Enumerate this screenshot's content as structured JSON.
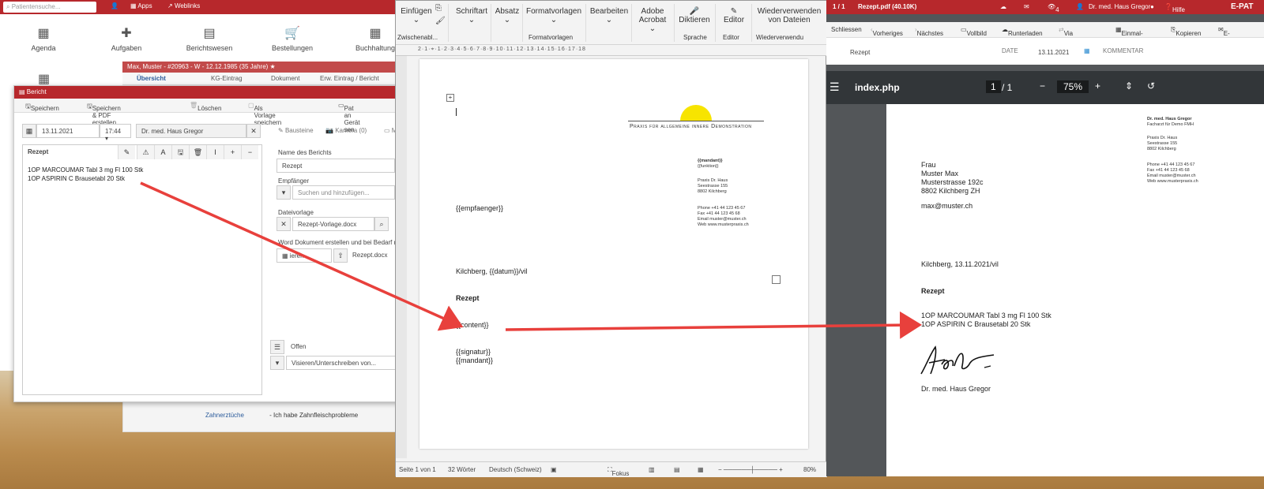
{
  "epat": {
    "search_placeholder": "Patientensuche...",
    "apps": "Apps",
    "weblinks": "Weblinks",
    "tiles": [
      "Agenda",
      "Aufgaben",
      "Berichtswesen",
      "Bestellungen",
      "Buchhaltung"
    ],
    "patient_header": "Max, Muster - #20963 - W - 12.12.1985 (35 Jahre)",
    "patient_tabs": [
      "Übersicht",
      "KG-Eintrag",
      "Dokument",
      "Erw. Eintrag / Bericht"
    ],
    "zahn_link": "Zahnerztüche",
    "zahn_text": "- Ich habe Zahnfleischprobleme"
  },
  "bericht": {
    "title": "Bericht",
    "toolbar": {
      "save": "Speichern",
      "save_pdf": "Speichern & PDF erstellen",
      "delete": "Löschen",
      "as_template": "Als Vorlage speichern",
      "device": "Pat an Gerät sen"
    },
    "date": "13.11.2021",
    "time": "17:44",
    "doctor": "Dr. med. Haus Gregor",
    "editor_label": "Rezept",
    "content_lines": [
      "1OP MARCOUMAR Tabl 3 mg Fl 100 Stk",
      "1OP ASPIRIN C Brausetabl 20 Stk"
    ],
    "right_tabs": [
      "Bausteine",
      "Kamera (0)",
      "Me"
    ],
    "name_label": "Name des Berichts",
    "name_value": "Rezept",
    "recipient_label": "Empfänger",
    "recipient_placeholder": "Suchen und hinzufügen...",
    "template_label": "Dateivorlage",
    "template_value": "Rezept-Vorlage.docx",
    "word_hint": "Word Dokument erstellen und bei Bedarf mit d",
    "word_btn": "ieren",
    "file_btn": "Rezept.docx",
    "status": "Offen",
    "sign_placeholder": "Visieren/Unterschreiben von..."
  },
  "word": {
    "ribbon": [
      "Einfügen",
      "Schriftart",
      "Absatz",
      "Formatvorlagen",
      "Bearbeiten",
      "Adobe Acrobat",
      "Diktieren",
      "Editor",
      "Wiederverwenden von Dateien"
    ],
    "groups": [
      "Zwischenabl...",
      "Formatvorlagen",
      "Sprache",
      "Editor",
      "Wiederverwendu"
    ],
    "page": {
      "practice": "Praxis für allgemeine innere Demonstration",
      "mandant_bold": "{{mandant}}",
      "funktion": "{{funktion}}",
      "addr": [
        "Praxis Dr. Haus",
        "Seestrasse 155",
        "8802 Kilchberg"
      ],
      "contact": [
        "Phone +41 44 123 45 67",
        "Fax +41 44 123 45 68",
        "Email muster@muster.ch",
        "Web www.musterpraxis.ch"
      ],
      "empfaenger": "{{empfaenger}}",
      "datum_line": "Kilchberg, {{datum}}/vil",
      "rezept": "Rezept",
      "content": "{{content}}",
      "signatur": "{{signatur}}",
      "mandant": "{{mandant}}"
    },
    "status": {
      "page": "Seite 1 von 1",
      "words": "32 Wörter",
      "lang": "Deutsch (Schweiz)",
      "focus": "Fokus",
      "zoom": "80%"
    }
  },
  "pdf": {
    "tab_count": "1 / 1",
    "file_title": "Rezept.pdf (40.10K)",
    "eye_count": "4",
    "user": "Dr. med. Haus Gregor",
    "help": "Hilfe",
    "brand": "E-PAT",
    "toolbar": [
      "Schliessen",
      "Vorheriges",
      "Nächstes",
      "Vollbild",
      "Runterladen",
      "Via connector",
      "Einmal-Link",
      "Kopieren",
      "E-Ma"
    ],
    "meta_name": "Rezept",
    "meta_date_label": "DATE",
    "meta_date": "13.11.2021",
    "meta_comment_label": "KOMMENTAR",
    "viewer_title": "index.php",
    "page_current": "1",
    "page_total": "/ 1",
    "zoom": "75%",
    "doc": {
      "doctor_bold": "Dr. med. Haus Gregor",
      "doctor_sub": "Facharzt für Demo FMH",
      "addr": [
        "Praxis Dr. Haus",
        "Seestrasse 155",
        "8802 Kilchberg"
      ],
      "contact": [
        "Phone +41 44 123 45 67",
        "Fax +41 44 123 45 68",
        "Email muster@muster.ch",
        "Web www.musterpraxis.ch"
      ],
      "recipient": [
        "Frau",
        "Muster Max",
        "Musterstrasse 192c",
        "8802 Kilchberg ZH"
      ],
      "email": "max@muster.ch",
      "date_line": "Kilchberg, 13.11.2021/vil",
      "rezept": "Rezept",
      "lines": [
        "1OP MARCOUMAR Tabl 3 mg Fl 100 Stk",
        "1OP ASPIRIN C Brausetabl 20 Stk"
      ],
      "signature": "Dr. med. Haus Gregor"
    }
  },
  "colors": {
    "brand": "#b7282c",
    "arrow": "#e8403c",
    "sun": "#f7e400"
  }
}
